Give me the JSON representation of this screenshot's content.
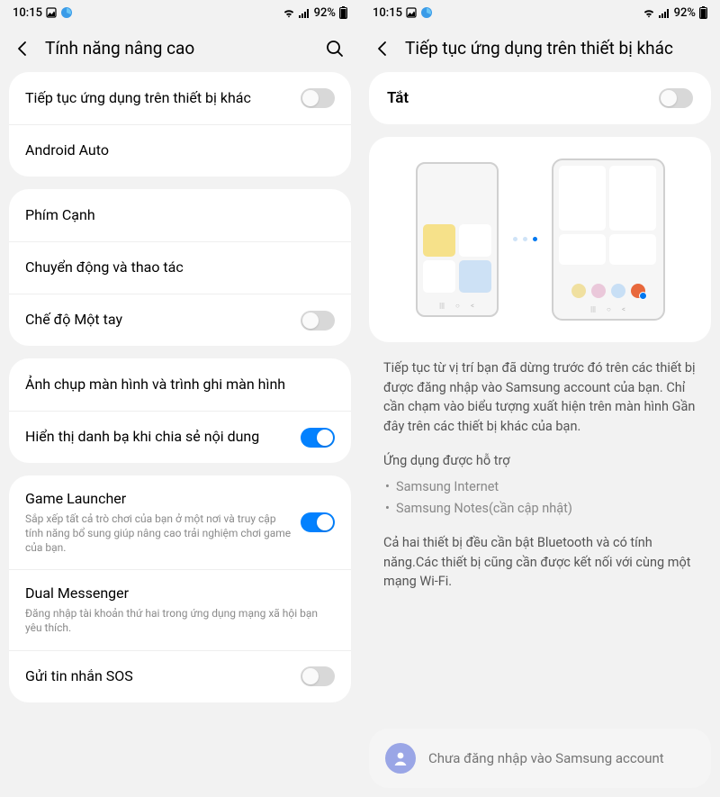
{
  "status": {
    "time": "10:15",
    "battery": "92%"
  },
  "left": {
    "title": "Tính năng nâng cao",
    "groups": [
      [
        {
          "title": "Tiếp tục ứng dụng trên thiết bị khác",
          "toggle": "off"
        },
        {
          "title": "Android Auto"
        }
      ],
      [
        {
          "title": "Phím Cạnh"
        },
        {
          "title": "Chuyển động và thao tác"
        },
        {
          "title": "Chế độ Một tay",
          "toggle": "off"
        }
      ],
      [
        {
          "title": "Ảnh chụp màn hình và trình ghi màn hình"
        },
        {
          "title": "Hiển thị danh bạ khi chia sẻ nội dung",
          "toggle": "on"
        }
      ],
      [
        {
          "title": "Game Launcher",
          "sub": "Sắp xếp tất cả trò chơi của bạn ở một nơi và truy cập tính năng bổ sung giúp nâng cao trải nghiệm chơi game của bạn.",
          "toggle": "on"
        },
        {
          "title": "Dual Messenger",
          "sub": "Đăng nhập tài khoản thứ hai trong ứng dụng mạng xã hội bạn yêu thích."
        },
        {
          "title": "Gửi tin nhắn SOS",
          "toggle": "off"
        }
      ]
    ]
  },
  "right": {
    "title": "Tiếp tục ứng dụng trên thiết bị khác",
    "toggle_label": "Tắt",
    "toggle_state": "off",
    "desc1": "Tiếp tục từ vị trí bạn đã dừng trước đó trên các thiết bị được đăng nhập vào Samsung account của bạn. Chỉ cần chạm vào biểu tượng xuất hiện trên màn hình Gần đây trên các thiết bị khác của bạn.",
    "apps_title": "Ứng dụng được hỗ trợ",
    "apps": [
      "Samsung Internet",
      "Samsung Notes(cần cập nhật)"
    ],
    "desc2": "Cả hai thiết bị đều cần bật Bluetooth và có tính năng.Các thiết bị cũng cần được kết nối với cùng một mạng Wi-Fi.",
    "signin": "Chưa đăng nhập vào Samsung account"
  }
}
